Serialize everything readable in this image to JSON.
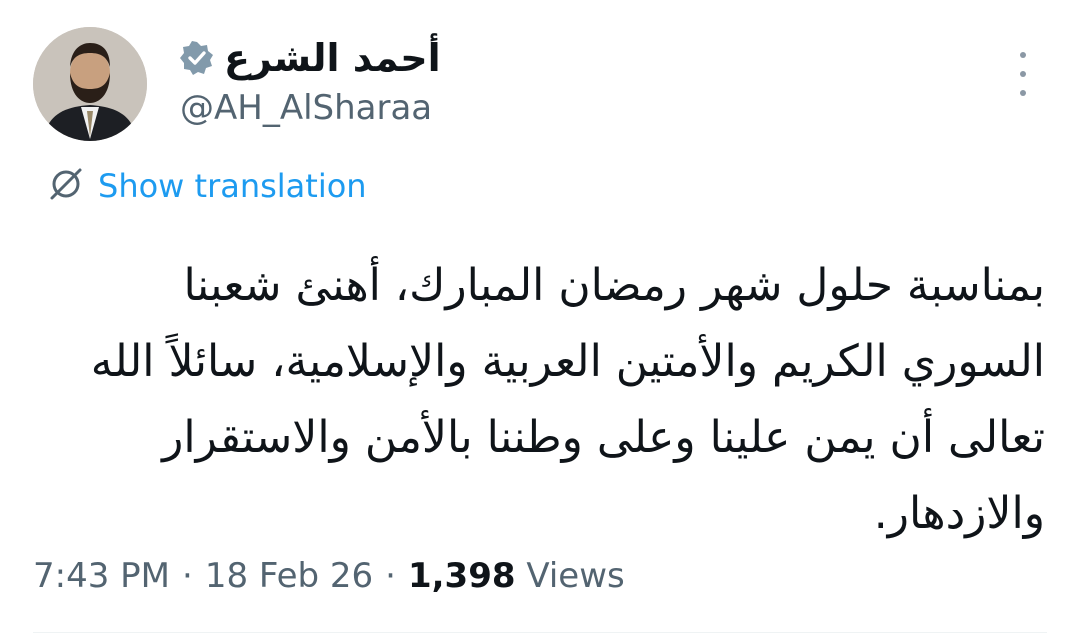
{
  "author": {
    "display_name": "أحمد الشرع",
    "handle": "@AH_AlSharaa",
    "verified_badge_icon": "verified-badge-icon",
    "badge_color": "#829aab"
  },
  "translate": {
    "icon": "translate-icon",
    "label": "Show translation",
    "color": "#1d9bf0"
  },
  "tweet": {
    "text": "بمناسبة حلول شهر رمضان المبارك، أهنئ شعبنا السوري الكريم والأمتين العربية والإسلامية، سائلاً الله تعالى أن يمن علينا وعلى وطننا بالأمن والاستقرار والازدهار."
  },
  "meta": {
    "time": "7:43 PM",
    "date": "18 Feb 26",
    "separator": "·",
    "views_count": "1,398",
    "views_label": "Views"
  },
  "more_menu": {
    "icon": "more-vertical-icon"
  }
}
